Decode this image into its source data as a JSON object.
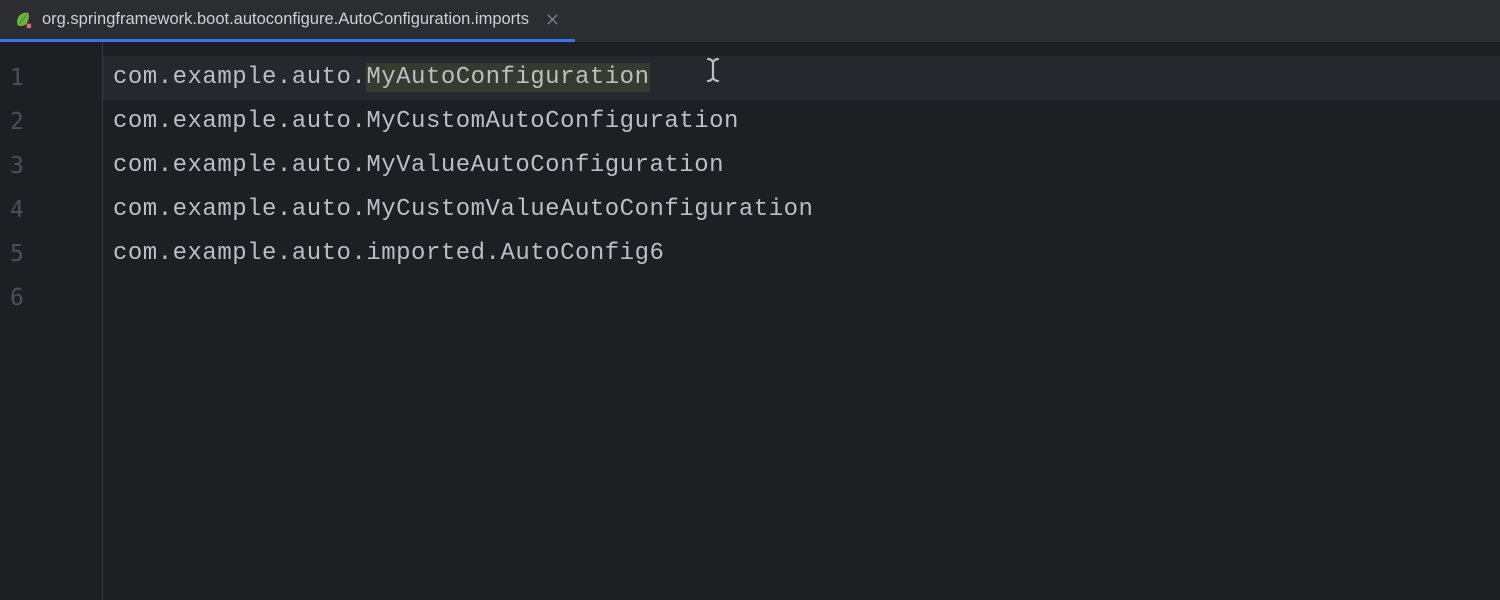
{
  "tab": {
    "filename": "org.springframework.boot.autoconfigure.AutoConfiguration.imports",
    "icon_name": "spring-leaf-icon"
  },
  "editor": {
    "lines": [
      {
        "num": "1",
        "prefix": "com.example.auto.",
        "highlighted": "MyAutoConfiguration",
        "suffix": ""
      },
      {
        "num": "2",
        "prefix": "com.example.auto.MyCustomAutoConfiguration",
        "highlighted": "",
        "suffix": ""
      },
      {
        "num": "3",
        "prefix": "com.example.auto.MyValueAutoConfiguration",
        "highlighted": "",
        "suffix": ""
      },
      {
        "num": "4",
        "prefix": "com.example.auto.MyCustomValueAutoConfiguration",
        "highlighted": "",
        "suffix": ""
      },
      {
        "num": "5",
        "prefix": "com.example.auto.imported.AutoConfig6",
        "highlighted": "",
        "suffix": ""
      },
      {
        "num": "6",
        "prefix": "",
        "highlighted": "",
        "suffix": ""
      }
    ],
    "active_line_index": 0
  }
}
